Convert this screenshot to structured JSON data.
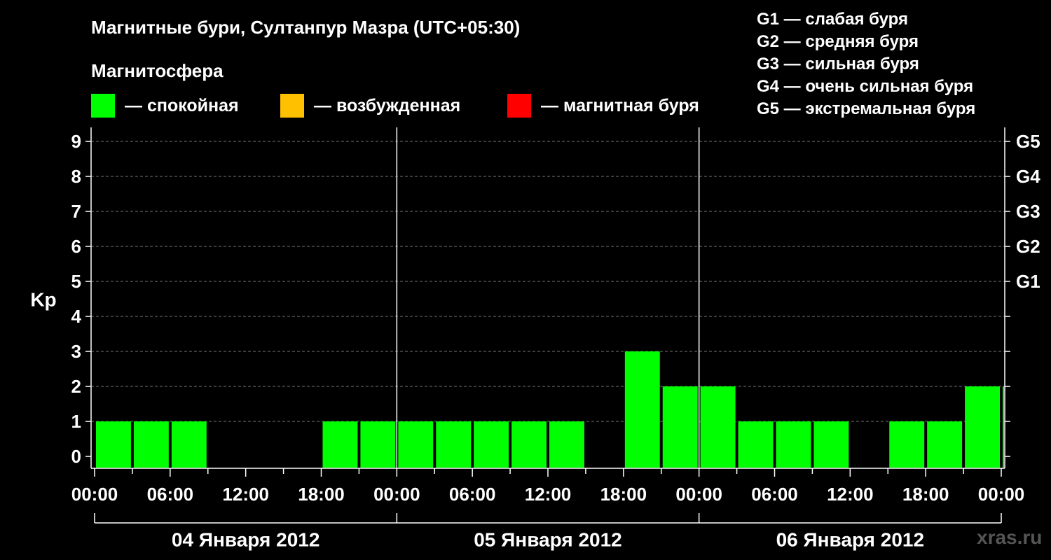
{
  "header": {
    "title": "Магнитные бури, Султанпур Мазра (UTC+05:30)",
    "subtitle": "Магнитосфера"
  },
  "legend": [
    {
      "label": "— спокойная",
      "color": "#00ff00"
    },
    {
      "label": "— возбужденная",
      "color": "#ffc000"
    },
    {
      "label": "— магнитная буря",
      "color": "#ff0000"
    }
  ],
  "g_scale": [
    "G1 — слабая буря",
    "G2 — средняя буря",
    "G3 — сильная буря",
    "G4 — очень сильная буря",
    "G5 — экстремальная буря"
  ],
  "watermark": "xras.ru",
  "chart_data": {
    "type": "bar",
    "ylabel": "Kp",
    "ylim": [
      0,
      9
    ],
    "yticks": [
      "0",
      "1",
      "2",
      "3",
      "4",
      "5",
      "6",
      "7",
      "8",
      "9"
    ],
    "right_ticks": [
      {
        "value": 5,
        "label": "G1"
      },
      {
        "value": 6,
        "label": "G2"
      },
      {
        "value": 7,
        "label": "G3"
      },
      {
        "value": 8,
        "label": "G4"
      },
      {
        "value": 9,
        "label": "G5"
      }
    ],
    "xlim_hours": [
      0,
      72
    ],
    "xtick_labels": [
      "00:00",
      "06:00",
      "12:00",
      "18:00",
      "00:00",
      "06:00",
      "12:00",
      "18:00",
      "00:00",
      "06:00",
      "12:00",
      "18:00",
      "00:00"
    ],
    "days": [
      "04 Января 2012",
      "05 Января 2012",
      "06 Января 2012"
    ],
    "grid": "horizontal dashed",
    "bars": [
      {
        "start": 0,
        "end": 3,
        "value": 1,
        "color": "#00ff00"
      },
      {
        "start": 3,
        "end": 6,
        "value": 1,
        "color": "#00ff00"
      },
      {
        "start": 6,
        "end": 9,
        "value": 1,
        "color": "#00ff00"
      },
      {
        "start": 18,
        "end": 21,
        "value": 1,
        "color": "#00ff00"
      },
      {
        "start": 21,
        "end": 24,
        "value": 1,
        "color": "#00ff00"
      },
      {
        "start": 24,
        "end": 27,
        "value": 1,
        "color": "#00ff00"
      },
      {
        "start": 27,
        "end": 30,
        "value": 1,
        "color": "#00ff00"
      },
      {
        "start": 30,
        "end": 33,
        "value": 1,
        "color": "#00ff00"
      },
      {
        "start": 33,
        "end": 36,
        "value": 1,
        "color": "#00ff00"
      },
      {
        "start": 36,
        "end": 39,
        "value": 1,
        "color": "#00ff00"
      },
      {
        "start": 42,
        "end": 45,
        "value": 3,
        "color": "#00ff00"
      },
      {
        "start": 45,
        "end": 48,
        "value": 2,
        "color": "#00ff00"
      },
      {
        "start": 48,
        "end": 51,
        "value": 2,
        "color": "#00ff00"
      },
      {
        "start": 51,
        "end": 54,
        "value": 1,
        "color": "#00ff00"
      },
      {
        "start": 54,
        "end": 57,
        "value": 1,
        "color": "#00ff00"
      },
      {
        "start": 57,
        "end": 60,
        "value": 1,
        "color": "#00ff00"
      },
      {
        "start": 63,
        "end": 66,
        "value": 1,
        "color": "#00ff00"
      },
      {
        "start": 66,
        "end": 69,
        "value": 1,
        "color": "#00ff00"
      },
      {
        "start": 69,
        "end": 72,
        "value": 2,
        "color": "#00ff00"
      },
      {
        "start": 72,
        "end": 72,
        "value": 2,
        "color": "#00ff00"
      }
    ]
  }
}
